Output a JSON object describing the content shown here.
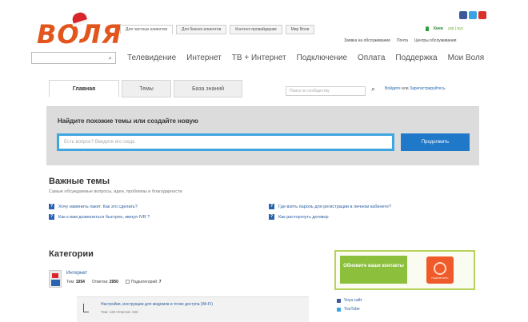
{
  "header": {
    "logo_text": "ВОЛЯ",
    "top_tabs": [
      "Для частных клиентов",
      "Для бизнес-клиентов",
      "Контент-провайдерам",
      "Мир Воли"
    ],
    "city": "Киев",
    "lang": "укр | рус",
    "sub_links": [
      "Заявка на обслуживание",
      "Почта",
      "Центры обслуживания"
    ],
    "search_icon": "search-icon",
    "social_icons": [
      "facebook-icon",
      "twitter-icon",
      "youtube-icon"
    ]
  },
  "main_nav": {
    "items": [
      "Телевидение",
      "Интернет",
      "ТВ + Интернет",
      "Подключение",
      "Оплата",
      "Поддержка",
      "Мои Воля"
    ]
  },
  "forum": {
    "tabs": [
      "Главная",
      "Темы",
      "База знаний"
    ],
    "search_placeholder": "Поиск по сообществу",
    "login": "Войдите",
    "or": "или",
    "register": "Зарегистрируйтесь"
  },
  "ask": {
    "title": "Найдите похожие темы или создайте новую",
    "placeholder": "Есть вопрос? Введите его сюда",
    "button": "Продолжить"
  },
  "important": {
    "title": "Важные темы",
    "subtitle": "Самые обсуждаемые вопросы, идеи, проблемы и благодарности",
    "topics": [
      "Хочу изменить пакет. Как это сделать?",
      "Как к вам дозвониться быстрее, минуя IVR ?",
      "Где взять пароль для регистрации в личном кабинете?",
      "Как расторгнуть договор"
    ]
  },
  "categories": {
    "title": "Категории",
    "item": {
      "name": "Интернет",
      "themes_label": "Тем:",
      "themes": "1054",
      "answers_label": "Ответов:",
      "answers": "2950",
      "subcats_label": "Подкатегорий:",
      "subcats": "7"
    },
    "subitem": {
      "title": "Настройки, инструкции для модемов и точек доступа (Wi-Fi)",
      "meta": "Тем: 120    Ответов: 340"
    }
  },
  "promo": {
    "green_text": "Обновите ваши контакты",
    "orange_caption": "ПОДКЛЮЧИТЬ"
  },
  "follow": [
    "Voya сайт",
    "YouTube"
  ],
  "colors": {
    "logo": "#e2561d",
    "accent_blue": "#1f78c8",
    "input_border": "#3fa6e0",
    "promo_green": "#8bbf3c",
    "promo_orange": "#ef5a2a"
  }
}
